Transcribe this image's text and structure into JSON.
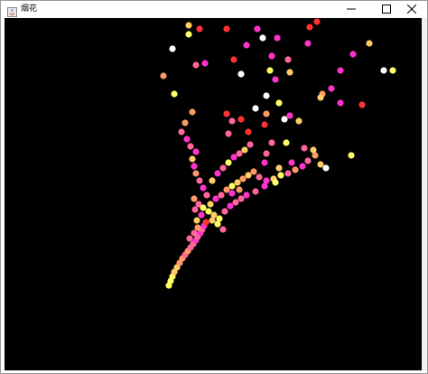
{
  "window": {
    "title": "烟花",
    "controls": {
      "minimize_icon": "minimize-icon",
      "maximize_icon": "maximize-icon",
      "close_icon": "close-icon"
    },
    "canvas_background": "#000000"
  },
  "fireworks": {
    "palette": [
      "#ffff66",
      "#ffcc66",
      "#ff9966",
      "#ff6699",
      "#ff33cc",
      "#ff3333",
      "#ffffff"
    ],
    "description_hidden": ""
  }
}
